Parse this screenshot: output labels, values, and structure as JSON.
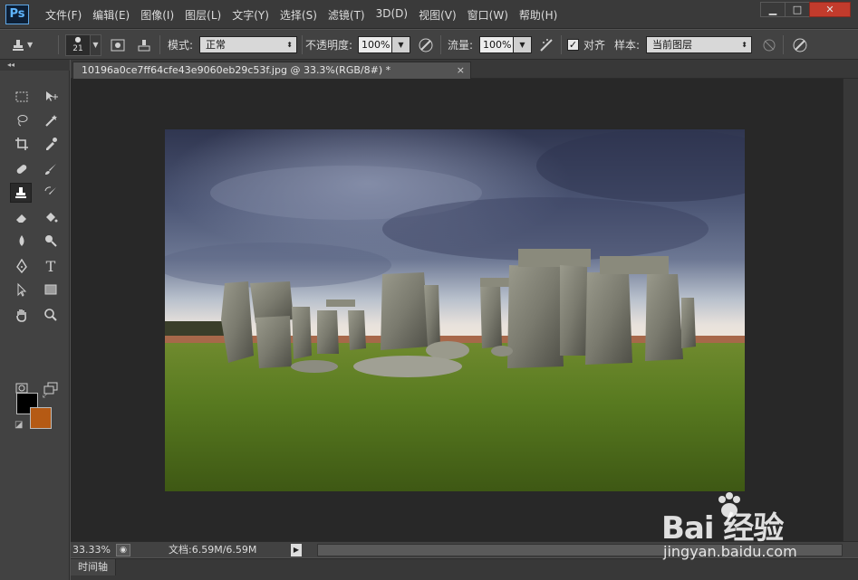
{
  "app": {
    "logo": "Ps",
    "menu": [
      "文件(F)",
      "编辑(E)",
      "图像(I)",
      "图层(L)",
      "文字(Y)",
      "选择(S)",
      "滤镜(T)",
      "3D(D)",
      "视图(V)",
      "窗口(W)",
      "帮助(H)"
    ],
    "window_controls": [
      "minimize-icon",
      "maximize-icon",
      "close-icon"
    ]
  },
  "options": {
    "brush_size": "21",
    "mode_label": "模式:",
    "mode_value": "正常",
    "opacity_label": "不透明度:",
    "opacity_value": "100%",
    "flow_label": "流量:",
    "flow_value": "100%",
    "align_label": "对齐",
    "align_checked": true,
    "sample_label": "样本:",
    "sample_value": "当前图层"
  },
  "tools": [
    "marquee-icon",
    "move-icon",
    "lasso-icon",
    "magic-wand-icon",
    "crop-icon",
    "eyedropper-icon",
    "healing-brush-icon",
    "brush-icon",
    "clone-stamp-icon",
    "history-brush-icon",
    "eraser-icon",
    "paint-bucket-icon",
    "blur-icon",
    "dodge-icon",
    "pen-icon",
    "text-icon",
    "path-select-icon",
    "rectangle-icon",
    "hand-icon",
    "zoom-icon",
    "quick-mask-icon",
    "screen-mode-icon"
  ],
  "colors": {
    "foreground": "#000000",
    "background": "#b55a14"
  },
  "document": {
    "tab_title": "10196a0ce7ff64cfe43e9060eb29c53f.jpg @ 33.3%(RGB/8#) *",
    "close_label": "×"
  },
  "status": {
    "zoom": "33.33%",
    "doc_info": "文档:6.59M/6.59M"
  },
  "timeline": {
    "tab_label": "时间轴"
  },
  "watermark": {
    "brand": "Bai 经验",
    "site": "jingyan.baidu.com"
  }
}
